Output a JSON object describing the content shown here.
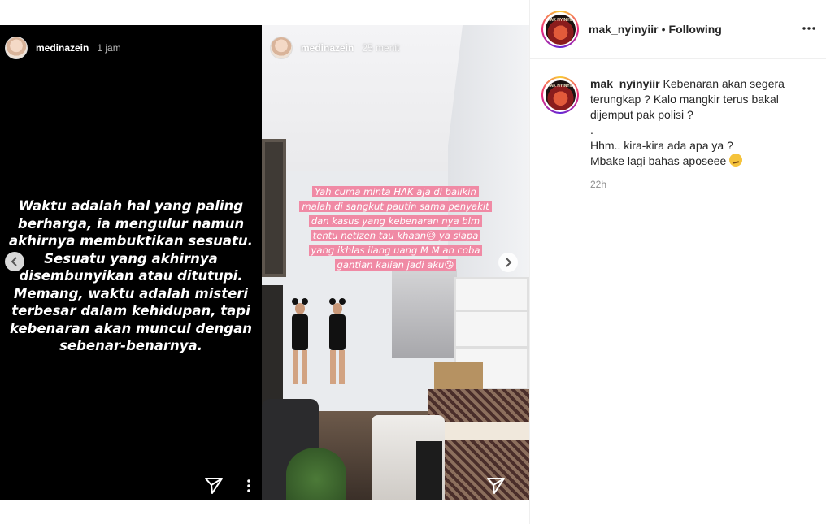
{
  "stories": {
    "left": {
      "username": "medinazein",
      "time": "1 jam",
      "text": "Waktu adalah hal yang paling berharga, ia mengulur namun akhirnya membuktikan sesuatu. Sesuatu yang akhirnya disembunyikan atau ditutupi. Memang, waktu adalah misteri terbesar dalam kehidupan, tapi kebenaran akan muncul dengan sebenar-benarnya."
    },
    "right": {
      "username": "medinazein",
      "time": "25 menit",
      "caption_lines": [
        "Yah cuma minta HAK aja di balikin",
        "malah di sangkut pautin sama penyakit",
        "dan kasus yang kebenaran nya blm",
        "tentu netizen tau khaan😥 ya siapa",
        "yang ikhlas ilang uang M M an coba",
        "gantian kalian jadi aku😘"
      ]
    }
  },
  "post": {
    "author": "mak_nyinyiir",
    "separator": "•",
    "follow_state": "Following",
    "avatar_text": "MAK NYINYIR",
    "caption": "Kebenaran akan segera terungkap ? Kalo mangkir terus bakal dijemput pak polisi ?\n.\nHhm.. kira-kira ada apa ya ?\nMbake lagi bahas aposeee ",
    "time": "22h"
  },
  "icons": {
    "send": "send-icon",
    "more": "more-icon",
    "prev": "chevron-left-icon",
    "next": "chevron-right-icon",
    "options": "options-icon",
    "thinking_emoji": "thinking-face-icon"
  },
  "colors": {
    "caption_highlight": "#f08aa5",
    "story_ring": "#ee2a7b"
  }
}
